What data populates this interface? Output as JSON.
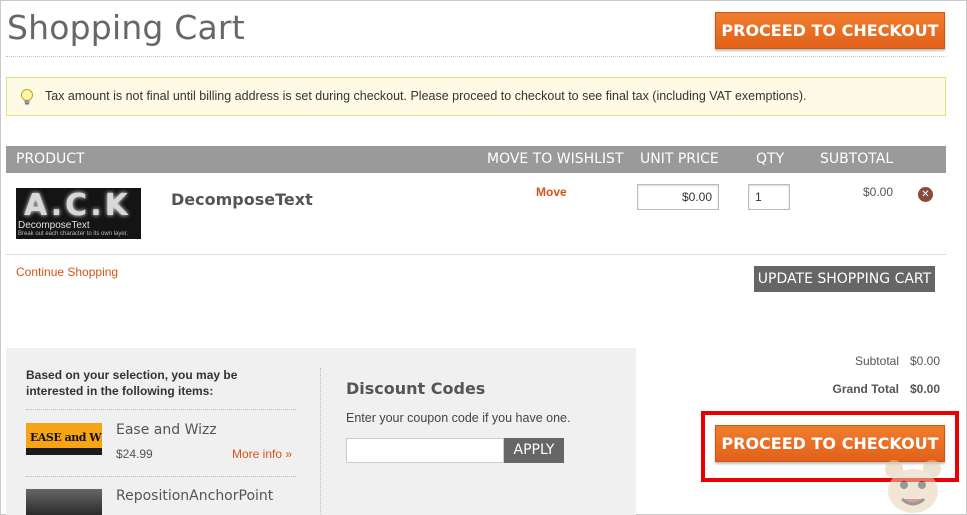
{
  "page": {
    "title": "Shopping Cart"
  },
  "checkout": {
    "top_label": "PROCEED TO CHECKOUT",
    "bottom_label": "PROCEED TO CHECKOUT"
  },
  "notice": {
    "text": "Tax amount is not final until billing address is set during checkout. Please proceed to checkout to see final tax (including VAT exemptions).",
    "icon": "lightbulb-icon"
  },
  "cart": {
    "headers": {
      "product": "PRODUCT",
      "wishlist": "MOVE TO WISHLIST",
      "unit_price": "UNIT PRICE",
      "qty": "QTY",
      "subtotal": "SUBTOTAL"
    },
    "item": {
      "name": "DecomposeText",
      "thumb_big": "A.C.K",
      "thumb_name": "DecomposeText",
      "thumb_desc": "Break out each character to its own layer.",
      "move_label": "Move",
      "unit_price": "$0.00",
      "qty": "1",
      "subtotal": "$0.00",
      "remove_icon": "remove-x-icon"
    },
    "continue_label": "Continue Shopping",
    "update_label": "UPDATE SHOPPING CART"
  },
  "crosssell": {
    "heading": "Based on your selection, you may be interested in the following items:",
    "items": [
      {
        "name": "Ease and Wizz",
        "price": "$24.99",
        "more": "More info »",
        "thumb_text": "EASE and WIZZ"
      },
      {
        "name": "RepositionAnchorPoint"
      }
    ]
  },
  "discount": {
    "title": "Discount Codes",
    "help": "Enter your coupon code if you have one.",
    "placeholder": "",
    "apply_label": "APPLY"
  },
  "totals": {
    "subtotal_label": "Subtotal",
    "subtotal_value": "$0.00",
    "grand_label": "Grand Total",
    "grand_value": "$0.00"
  },
  "colors": {
    "accent": "#e2611a",
    "highlight": "#ea0000",
    "header_bg": "#9a9a9a",
    "link": "#d4531a"
  }
}
